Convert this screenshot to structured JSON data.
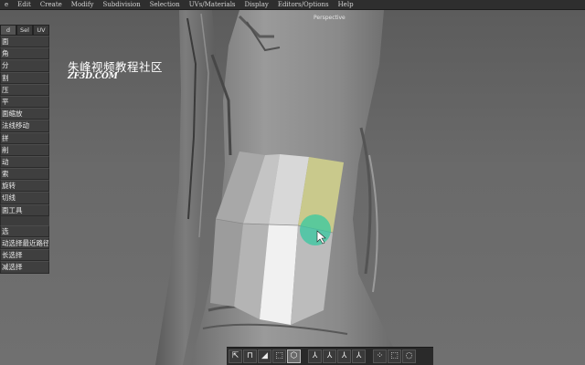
{
  "menubar": [
    "e",
    "Edit",
    "Create",
    "Modify",
    "Subdivision",
    "Selection",
    "UVs/Materials",
    "Display",
    "Editors/Options",
    "Help"
  ],
  "viewport": {
    "camera_label": "Perspective"
  },
  "watermark": {
    "cn": "朱峰视频教程社区",
    "en": "ZF3D.COM"
  },
  "panel": {
    "tabs": [
      "d",
      "Sel",
      "UV"
    ],
    "buttons": [
      "面",
      "角",
      "分",
      "割",
      "压",
      "平",
      "面缩放",
      "法线移动",
      "拼",
      "削",
      "动",
      "索",
      "旋转",
      "切线",
      "面工具"
    ],
    "select_buttons": [
      "选",
      "动选择最近路径",
      "长选择",
      "减选择"
    ]
  },
  "shelf": {
    "tools": [
      {
        "icon": "move-component-icon",
        "glyph": "⇱"
      },
      {
        "icon": "extrude-icon",
        "glyph": "⊓"
      },
      {
        "icon": "bevel-icon",
        "glyph": "◢"
      },
      {
        "icon": "cube-select-icon",
        "glyph": "⬚"
      },
      {
        "icon": "hexagon-icon",
        "glyph": "⬡",
        "selected": true
      },
      {
        "icon": "axis-x-icon",
        "glyph": "⅄"
      },
      {
        "icon": "axis-y-icon",
        "glyph": "⅄"
      },
      {
        "icon": "axis-z-icon",
        "glyph": "⅄"
      },
      {
        "icon": "axis-world-icon",
        "glyph": "⅄"
      },
      {
        "icon": "points-mode-icon",
        "glyph": "⁘"
      },
      {
        "icon": "marquee-select-icon",
        "glyph": "⬚"
      },
      {
        "icon": "lasso-select-icon",
        "glyph": "◌"
      }
    ]
  },
  "colors": {
    "selected_face": "#c9c98c",
    "highlight_face": "#f1f1f1",
    "cursor_ring": "#36c8a0"
  }
}
